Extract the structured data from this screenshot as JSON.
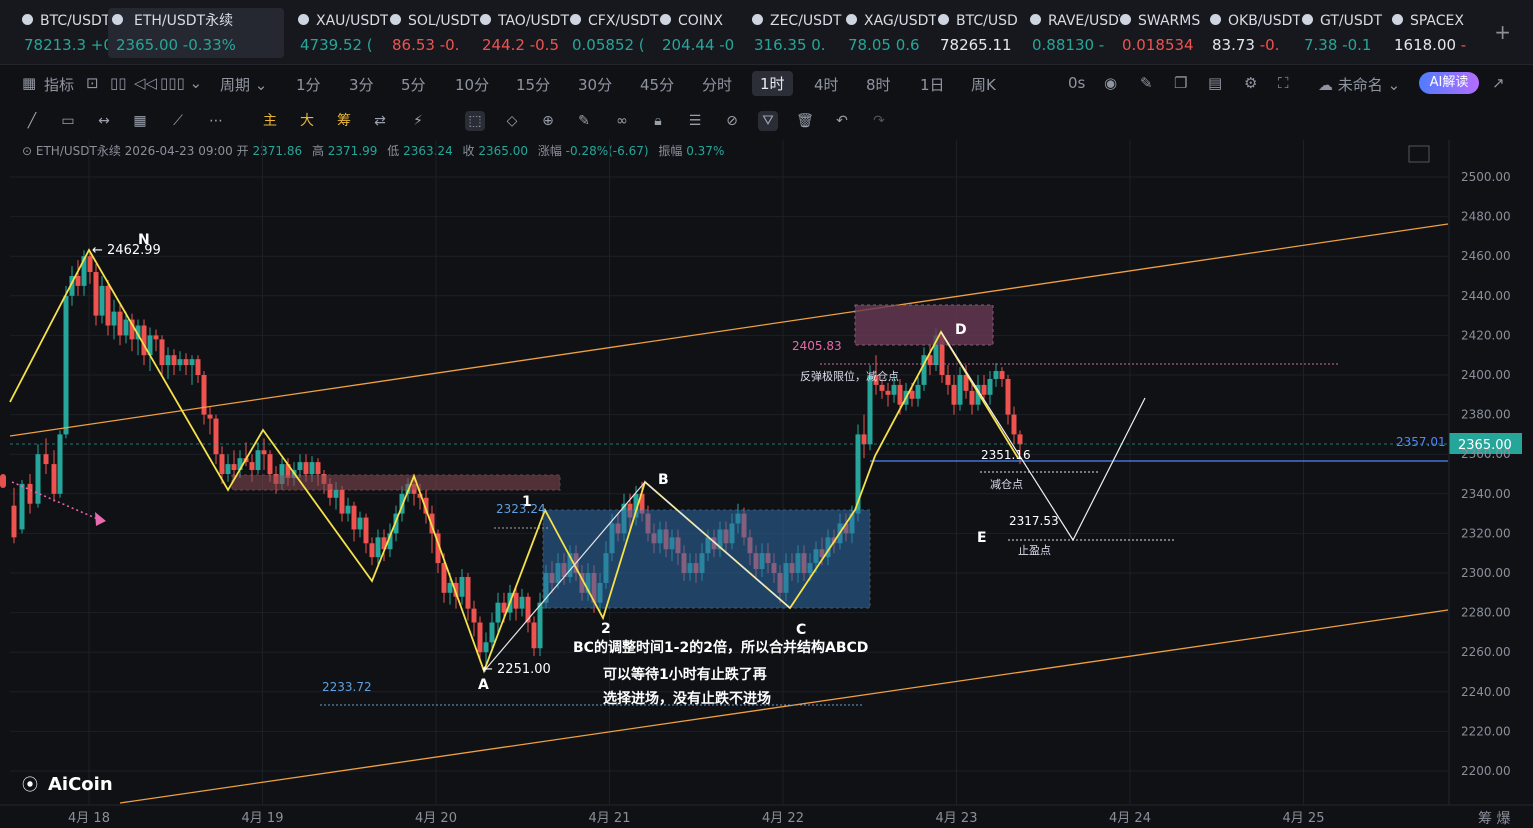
{
  "tickers": [
    {
      "name": "BTC/USDT",
      "price": "78213.3",
      "change": "+0.",
      "dir": "up",
      "icon": "btc-icon"
    },
    {
      "name": "ETH/USDT永续",
      "price": "2365.00",
      "change": "-0.33%",
      "dir": "dn",
      "icon": "eth-icon",
      "active": true
    },
    {
      "name": "XAU/USDT",
      "price": "4739.52",
      "change": "(",
      "dir": "up",
      "icon": "xau-icon"
    },
    {
      "name": "SOL/USDT",
      "price": "86.53",
      "change": "-0.",
      "dir": "dn",
      "icon": "sol-icon"
    },
    {
      "name": "TAO/USDT",
      "price": "244.2",
      "change": "-0.5",
      "dir": "dn",
      "icon": "tao-icon"
    },
    {
      "name": "CFX/USDT",
      "price": "0.05852",
      "change": "(",
      "dir": "up",
      "icon": "cfx-icon"
    },
    {
      "name": "COINX",
      "price": "204.44",
      "change": "-0",
      "dir": "up",
      "icon": "coinx-icon"
    },
    {
      "name": "ZEC/USDT",
      "price": "316.35",
      "change": "0.",
      "dir": "up",
      "icon": "zec-icon"
    },
    {
      "name": "XAG/USDT",
      "price": "78.05",
      "change": "0.6",
      "dir": "up",
      "icon": "xag-icon"
    },
    {
      "name": "BTC/USD",
      "price": "78265.11",
      "change": "",
      "dir": "wh",
      "icon": "btc-usd-icon"
    },
    {
      "name": "RAVE/USDT",
      "price": "0.88130",
      "change": "-",
      "dir": "up",
      "icon": "rave-icon"
    },
    {
      "name": "SWARMS",
      "price": "0.018534",
      "change": "",
      "dir": "dn",
      "icon": "swarms-icon"
    },
    {
      "name": "OKB/USDT",
      "price": "83.73",
      "change": "-0.",
      "dir": "wh",
      "icon": "okb-icon"
    },
    {
      "name": "GT/USDT",
      "price": "7.38",
      "change": "-0.1",
      "dir": "up",
      "icon": "gt-icon"
    },
    {
      "name": "SPACEX",
      "price": "1618.00",
      "change": "-",
      "dir": "wh",
      "icon": "spacex-icon"
    }
  ],
  "toolbar": {
    "indicators": "指标",
    "period": "周期",
    "timeframes": [
      "1分",
      "3分",
      "5分",
      "10分",
      "15分",
      "30分",
      "45分",
      "分时",
      "1时",
      "4时",
      "8时",
      "1日",
      "周K"
    ],
    "selected_tf": "1时",
    "countdown": "0s",
    "unnamed": "未命名",
    "ai": "AI解读"
  },
  "drawtools": [
    "主",
    "大",
    "筹"
  ],
  "info": {
    "symbol": "ETH/USDT永续",
    "time": "2026-04-23 09:00",
    "open_label": "开",
    "open": "2371.86",
    "high_label": "高",
    "high": "2371.99",
    "low_label": "低",
    "low": "2363.24",
    "close_label": "收",
    "close": "2365.00",
    "amp_label": "涨幅",
    "amp": "-0.28%(-6.67)",
    "range_label": "振幅",
    "range": "0.37%"
  },
  "chart": {
    "y_ticks": [
      "2500.00",
      "2480.00",
      "2460.00",
      "2440.00",
      "2420.00",
      "2400.00",
      "2380.00",
      "2360.00",
      "2340.00",
      "2320.00",
      "2300.00",
      "2280.00",
      "2260.00",
      "2240.00",
      "2220.00",
      "2200.00"
    ],
    "x_ticks": [
      "4月 18",
      "4月 19",
      "4月 20",
      "4月 21",
      "4月 22",
      "4月 23",
      "4月 24",
      "4月 25"
    ],
    "current_price": "2365.00",
    "hline_price": "2357.01",
    "labels": {
      "N": "N",
      "high": "← 2462.99",
      "A": "A",
      "low": "← 2251.00",
      "B": "B",
      "C": "C",
      "D": "D",
      "E": "E",
      "one": "1",
      "two": "2",
      "p2323": "2323.24",
      "p2233": "2233.72",
      "p2405": "2405.83",
      "p2351": "2351.16",
      "p2317": "2317.53",
      "rebound": "反弹极限位，减仓点",
      "reduce": "减仓点",
      "tp": "止盈点",
      "note1": "BC的调整时间1-2的2倍，所以合并结构ABCD",
      "note2": "可以等待1小时有止跌了再",
      "note3": "选择进场，没有止跌不进场"
    },
    "bottom_right": "筹 爆",
    "brand": "AiCoin"
  },
  "colors": {
    "bg": "#0f1115",
    "up": "#26a69a",
    "down": "#ef5350",
    "zigzag": "#f5e14a",
    "channel": "#f0a040",
    "box": "#2e6aa5",
    "price_tag": "#26a69a"
  }
}
